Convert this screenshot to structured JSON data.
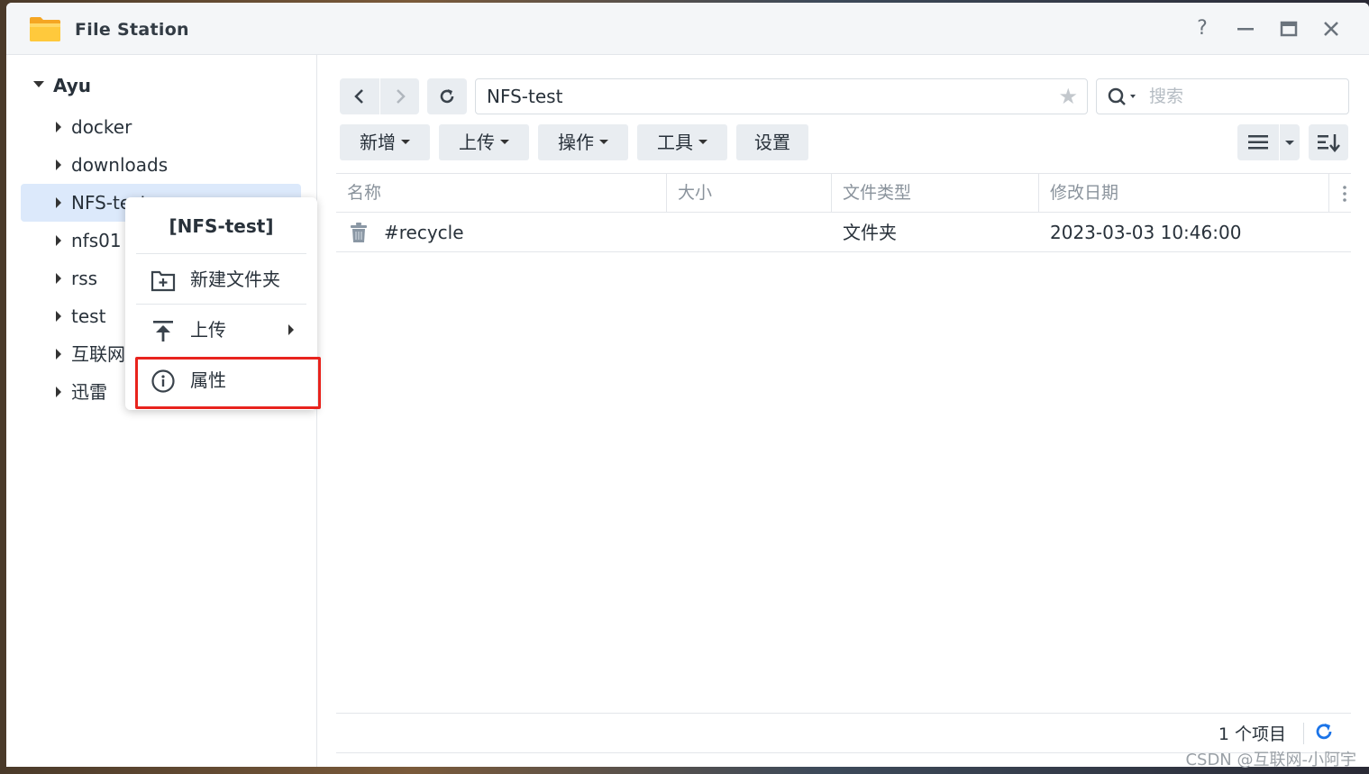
{
  "window": {
    "title": "File Station",
    "help_label": "?",
    "minimize_label": "—",
    "maximize_label": "▭",
    "close_label": "✕"
  },
  "sidebar": {
    "root": "Ayu",
    "items": [
      {
        "label": "docker"
      },
      {
        "label": "downloads"
      },
      {
        "label": "NFS-test",
        "selected": true
      },
      {
        "label": "nfs01"
      },
      {
        "label": "rss"
      },
      {
        "label": "test"
      },
      {
        "label": "互联网"
      },
      {
        "label": "迅雷"
      }
    ]
  },
  "context_menu": {
    "title": "[NFS-test]",
    "items": [
      {
        "label": "新建文件夹",
        "icon": "new-folder-icon"
      },
      {
        "label": "上传",
        "icon": "upload-icon",
        "has_submenu": true
      },
      {
        "label": "属性",
        "icon": "info-icon",
        "highlighted": true
      }
    ]
  },
  "toolbar": {
    "path": "NFS-test",
    "search_placeholder": "搜索",
    "buttons": [
      "新增",
      "上传",
      "操作",
      "工具",
      "设置"
    ]
  },
  "table": {
    "columns": [
      "名称",
      "大小",
      "文件类型",
      "修改日期"
    ],
    "rows": [
      {
        "name": "#recycle",
        "size": "",
        "type": "文件夹",
        "modified": "2023-03-03 10:46:00",
        "icon": "trash-icon"
      }
    ]
  },
  "footer": {
    "count": "1 个项目"
  },
  "watermark": "CSDN @互联网-小阿宇",
  "colors": {
    "accent": "#1b74e8",
    "highlight_border": "#e8231d",
    "selected_bg": "#dce9fb"
  }
}
